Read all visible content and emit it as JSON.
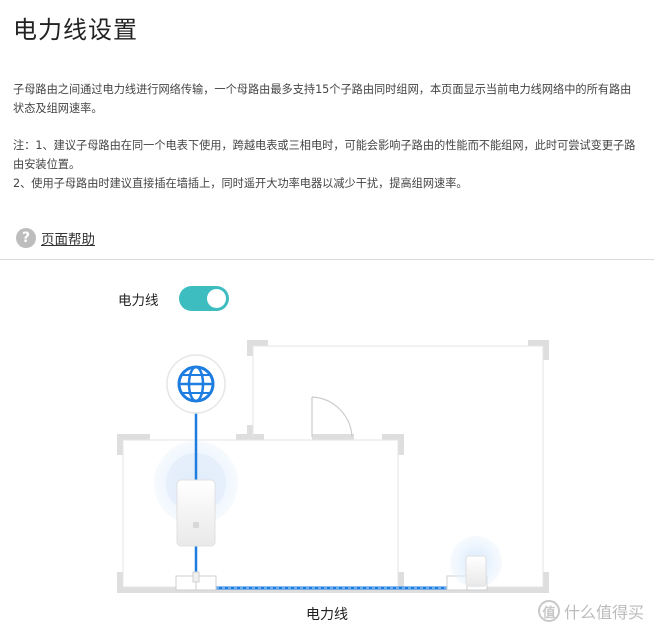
{
  "page": {
    "title": "电力线设置",
    "description": "子母路由之间通过电力线进行网络传输，一个母路由最多支持15个子路由同时组网，本页面显示当前电力线网络中的所有路由状态及组网速率。",
    "notes": [
      "注：1、建议子母路由在同一个电表下使用，跨越电表或三相电时，可能会影响子路由的性能而不能组网，此时可尝试变更子路由安装位置。",
      "2、使用子母路由时建议直接插在墙插上，同时遥开大功率电器以减少干扰，提高组网速率。"
    ],
    "help_link": "页面帮助",
    "help_icon_glyph": "?"
  },
  "toggle": {
    "label": "电力线",
    "state": "on",
    "color": "#3dbdbf"
  },
  "diagram": {
    "caption": "电力线",
    "globe_icon": "globe-icon",
    "line_color": "#1e7de0"
  },
  "watermark": {
    "text": "什么值得买",
    "glyph": "值"
  }
}
